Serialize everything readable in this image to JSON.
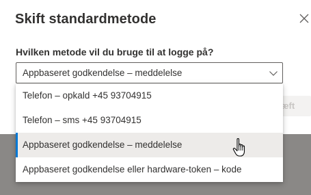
{
  "dialog": {
    "title": "Skift standardmetode",
    "close_icon": "close-icon",
    "question": "Hvilken metode vil du bruge til at logge på?",
    "select": {
      "value": "Appbaseret godkendelse – meddelelse",
      "icon": "chevron-down-icon"
    },
    "confirm_button_partial_label": "æft",
    "options": [
      {
        "label": "Telefon – opkald +45 93704915",
        "selected": false
      },
      {
        "label": "Telefon – sms +45 93704915",
        "selected": false
      },
      {
        "label": "Appbaseret godkendelse – meddelelse",
        "selected": true
      },
      {
        "label": "Appbaseret godkendelse eller hardware-token – kode",
        "selected": false
      }
    ]
  },
  "colors": {
    "accent": "#0078d4",
    "text": "#323130",
    "selected_bg": "#edebe9",
    "backdrop": "#8a8886"
  },
  "cursor_icon": "hand-pointer-icon"
}
